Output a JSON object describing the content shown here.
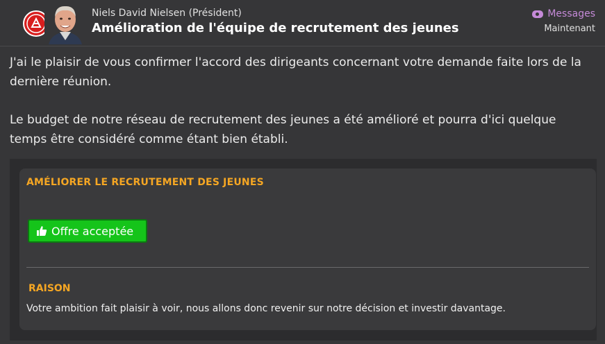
{
  "header": {
    "sender": "Niels David Nielsen  (Président)",
    "subject": "Amélioration de l'équipe de recrutement des jeunes",
    "messages_label": "Messages",
    "time": "Maintenant",
    "accent_color": "#c58ad8",
    "club_badge_icon": "club-badge-icon",
    "avatar_icon": "person-avatar"
  },
  "body": {
    "paragraph1": "J'ai le plaisir de vous confirmer l'accord des dirigeants concernant votre demande faite lors de la dernière réunion.",
    "paragraph2": "Le budget de notre réseau de recrutement des jeunes a été amélioré et pourra d'ici quelque temps être considéré comme étant bien établi."
  },
  "panel": {
    "title": "AMÉLIORER LE RECRUTEMENT DES JEUNES",
    "status_label": "Offre acceptée",
    "status_icon": "thumbs-up-icon",
    "status_color": "#15c41a",
    "reason_title": "RAISON",
    "reason_text": "Votre ambition fait plaisir à voir, nous allons donc revenir sur notre décision et investir davantage.",
    "title_color": "#f5a623"
  }
}
